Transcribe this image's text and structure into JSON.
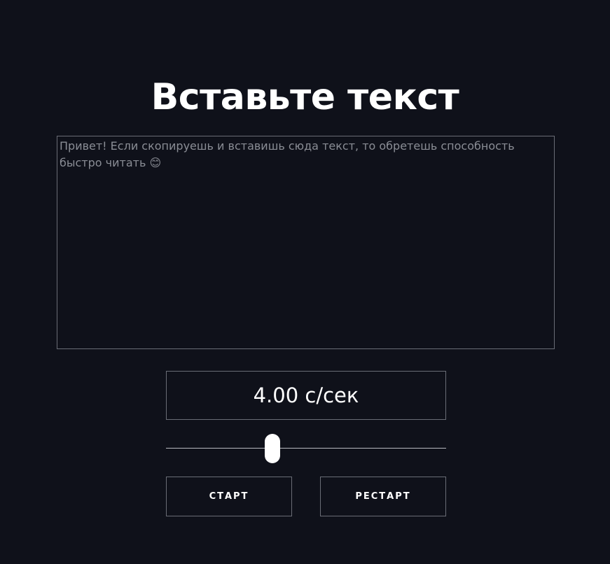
{
  "heading": {
    "title": "Вставьте текст"
  },
  "editor": {
    "placeholder": "Привет! Если скопируешь и вставишь сюда текст, то обретешь способность быстро читать 😊",
    "value": ""
  },
  "speed": {
    "display": "4.00 с/сек",
    "slider_fraction": 0.38
  },
  "controls": {
    "start_label": "СТАРТ",
    "restart_label": "РЕСТАРТ"
  },
  "colors": {
    "background": "#0f111a",
    "border": "#6a6d76",
    "text": "#ffffff",
    "placeholder": "#8a8d95"
  }
}
